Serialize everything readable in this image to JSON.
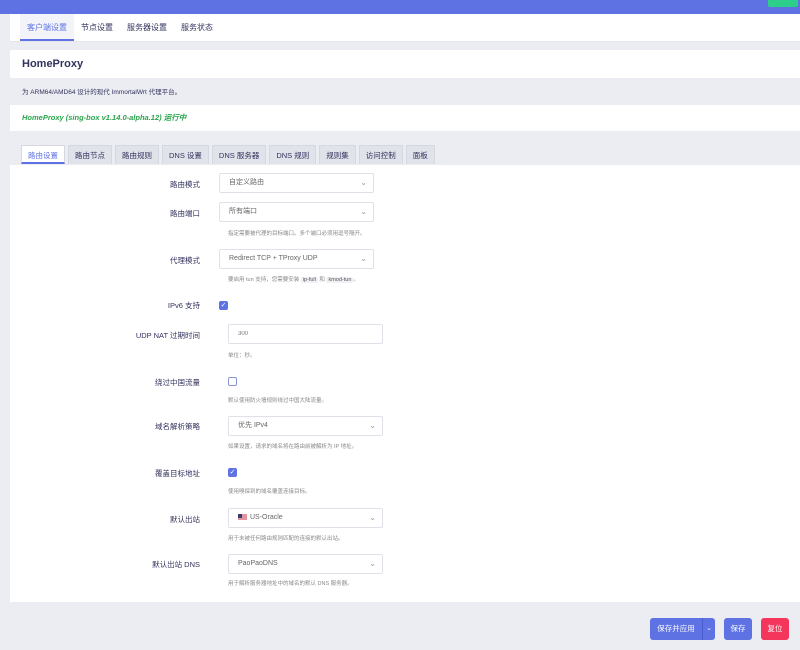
{
  "top_badge": "",
  "main_tabs": [
    {
      "label": "客户端设置"
    },
    {
      "label": "节点设置"
    },
    {
      "label": "服务器设置"
    },
    {
      "label": "服务状态"
    }
  ],
  "app_title": "HomeProxy",
  "description": "为 ARM64/AMD64 设计的现代 ImmortalWrt 代理平台。",
  "status": "HomeProxy (sing-box v1.14.0-alpha.12) 运行中",
  "sub_tabs": [
    {
      "label": "路由设置"
    },
    {
      "label": "路由节点"
    },
    {
      "label": "路由规则"
    },
    {
      "label": "DNS 设置"
    },
    {
      "label": "DNS 服务器"
    },
    {
      "label": "DNS 规则"
    },
    {
      "label": "规则集"
    },
    {
      "label": "访问控制"
    },
    {
      "label": "面板"
    }
  ],
  "form": {
    "routing_mode": {
      "label": "路由模式",
      "value": "自定义路由"
    },
    "routing_port": {
      "label": "路由端口",
      "value": "所有端口",
      "help": "指定需要被代理的目标端口。多个端口必须用逗号隔开。"
    },
    "proxy_mode": {
      "label": "代理模式",
      "value": "Redirect TCP + TProxy UDP",
      "help_prefix": "要启用 tun 支持，您需要安装",
      "help_pkg1": "ip-full",
      "help_and": "和",
      "help_pkg2": "kmod-tun",
      "help_suffix": "。"
    },
    "ipv6": {
      "label": "IPv6 支持",
      "checked": true
    },
    "udp_nat": {
      "label": "UDP NAT 过期时间",
      "placeholder": "300",
      "help": "单位：秒。"
    },
    "bypass_cn": {
      "label": "绕过中国流量",
      "checked": false,
      "help": "默认使用防火墙规则绕过中国大陆流量。"
    },
    "domain_strategy": {
      "label": "域名解析策略",
      "value": "优先 IPv4",
      "help": "如果设置，请求的域名将在路由前被解析为 IP 地址。"
    },
    "sniff_override": {
      "label": "覆盖目标地址",
      "checked": true,
      "help": "使用嗅探到的域名覆盖连接目标。"
    },
    "default_outbound": {
      "label": "默认出站",
      "value": "US-Oracle",
      "flag": "us-flag-icon",
      "help": "用于未被任何路由规则匹配的连接的默认出站。"
    },
    "default_outbound_dns": {
      "label": "默认出站 DNS",
      "value": "PaoPaoDNS",
      "help": "用于解析服务器地址中的域名的默认 DNS 服务器。"
    }
  },
  "footer": {
    "save_apply": "保存并应用",
    "save": "保存",
    "reset": "复位"
  },
  "colors": {
    "primary": "#5e72e4",
    "danger": "#f5365c",
    "success": "#2dce89",
    "status_text": "#2aa44b"
  }
}
